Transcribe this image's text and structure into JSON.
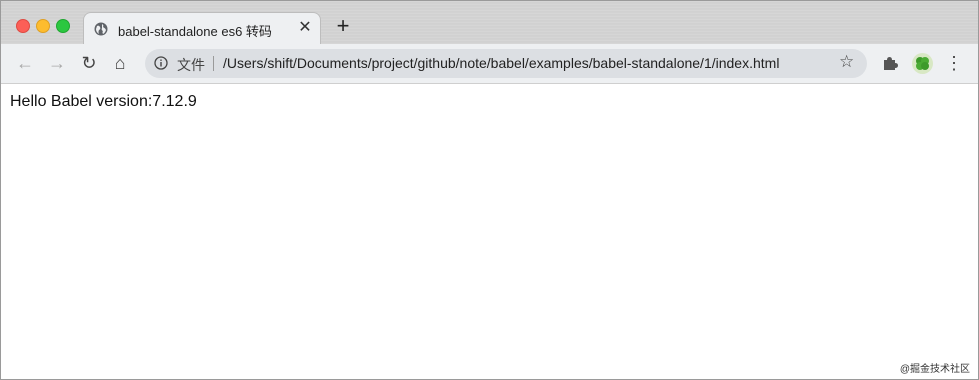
{
  "browser": {
    "tab": {
      "title": "babel-standalone es6 转码",
      "close_glyph": "✕",
      "icon": "globe-icon"
    },
    "new_tab_glyph": "+",
    "toolbar": {
      "back_glyph": "←",
      "forward_glyph": "→",
      "reload_glyph": "↻",
      "home_glyph": "⌂",
      "menu_glyph": "⋮"
    },
    "address_bar": {
      "scheme_label": "文件",
      "url": "/Users/shift/Documents/project/github/note/babel/examples/babel-standalone/1/index.html",
      "bookmark_glyph": "☆"
    }
  },
  "page": {
    "body_text": "Hello Babel version:7.12.9"
  },
  "watermark": "@掘金技术社区"
}
